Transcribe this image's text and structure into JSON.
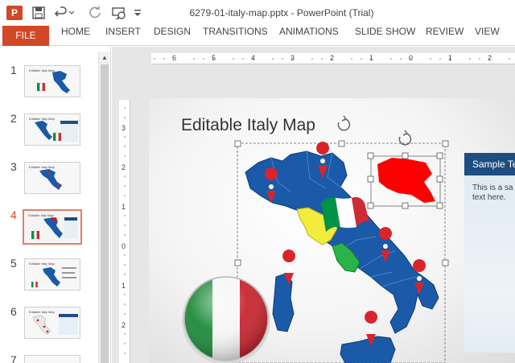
{
  "window": {
    "title": "6279-01-italy-map.pptx - PowerPoint (Trial)",
    "app_logo": "P"
  },
  "qat": {
    "icons": [
      "save-icon",
      "undo-icon",
      "undo-dropdown-icon",
      "redo-icon",
      "present-from-start-icon",
      "customize-qat-icon"
    ]
  },
  "ribbon": {
    "file_label": "FILE",
    "tabs": [
      {
        "label": "HOME"
      },
      {
        "label": "INSERT"
      },
      {
        "label": "DESIGN"
      },
      {
        "label": "TRANSITIONS"
      },
      {
        "label": "ANIMATIONS"
      },
      {
        "label": "SLIDE SHOW"
      },
      {
        "label": "REVIEW"
      },
      {
        "label": "VIEW"
      }
    ],
    "file_color": "#d24726"
  },
  "thumbnails": [
    {
      "number": "1",
      "title": "Editable Italy Map"
    },
    {
      "number": "2",
      "title": "Editable Italy Map"
    },
    {
      "number": "3",
      "title": "Editable Italy Map"
    },
    {
      "number": "4",
      "title": "Editable Italy Map",
      "active": true
    },
    {
      "number": "5",
      "title": "Editable Italy Map"
    },
    {
      "number": "6",
      "title": "Editable Italy Map"
    },
    {
      "number": "7",
      "title": ""
    }
  ],
  "ruler": {
    "horizontal": [
      "6",
      "5",
      "4",
      "3",
      "2",
      "1",
      "0",
      "1",
      "2"
    ],
    "vertical": [
      "3",
      "2",
      "1",
      "0",
      "1",
      "2"
    ]
  },
  "slide": {
    "title": "Editable Italy Map",
    "sample_box": {
      "header": "Sample Te",
      "body": "This is a sa\ntext here."
    },
    "colors": {
      "map_blue": "#1a5aa8",
      "pin_red": "#d9242c",
      "flag_green": "#009246",
      "flag_red": "#ce2b37",
      "highlight_red": "#ff0000",
      "tuscany_yellow": "#f2ec3a",
      "accent_dark_blue": "#1e4d80"
    }
  }
}
